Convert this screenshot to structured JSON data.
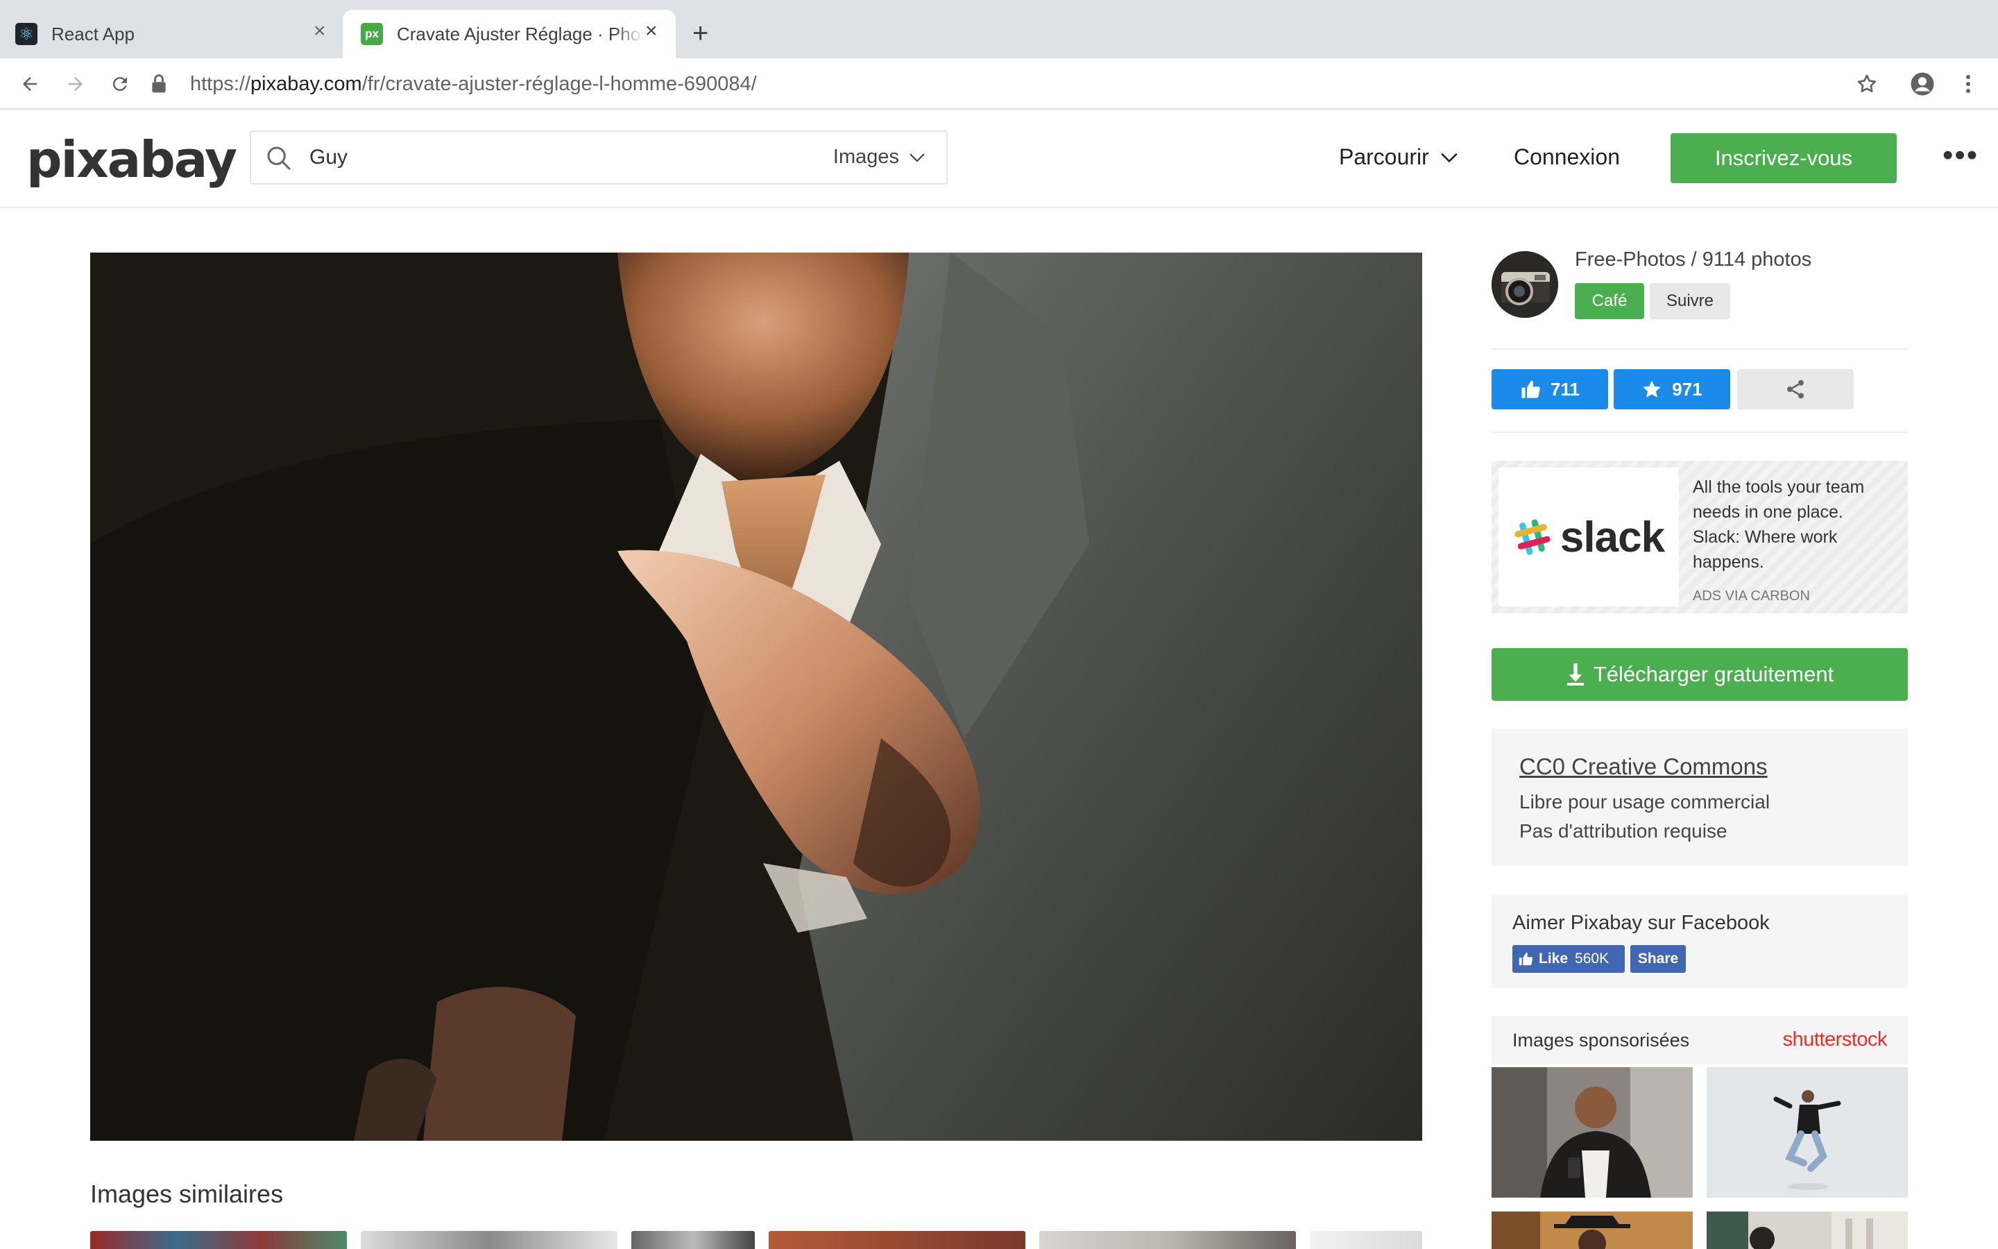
{
  "browser": {
    "tabs": [
      {
        "title": "React App",
        "close": "×"
      },
      {
        "title": "Cravate Ajuster Réglage · Photo",
        "favicon_text": "px",
        "close": "×"
      }
    ],
    "new_tab": "+",
    "url": {
      "scheme": "https://",
      "host": "pixabay.com",
      "path": "/fr/cravate-ajuster-réglage-l-homme-690084/"
    }
  },
  "header": {
    "logo": "pixabay",
    "search": {
      "value": "Guy",
      "type": "Images"
    },
    "browse": "Parcourir",
    "login": "Connexion",
    "signup": "Inscrivez-vous",
    "more": "•••"
  },
  "author": {
    "name": "Free-Photos / 9114 photos",
    "cafe": "Café",
    "follow": "Suivre"
  },
  "stats": {
    "likes": "711",
    "favorites": "971"
  },
  "ad": {
    "brand": "slack",
    "text": "All the tools your team needs in one place. Slack: Where work happens.",
    "via": "ADS VIA CARBON"
  },
  "download": "Télécharger gratuitement",
  "license": {
    "title": "CC0 Creative Commons",
    "line1": "Libre pour usage commercial",
    "line2": "Pas d'attribution requise"
  },
  "facebook": {
    "title": "Aimer Pixabay sur Facebook",
    "like": "Like",
    "count": "560K",
    "share": "Share"
  },
  "sponsored": {
    "title": "Images sponsorisées",
    "brand": "shutterstock"
  },
  "similar": {
    "title": "Images similaires"
  },
  "colors": {
    "green": "#4bae4f",
    "blue": "#1a8be8",
    "facebook": "#4267b2",
    "shutterstock": "#ee2b24"
  }
}
